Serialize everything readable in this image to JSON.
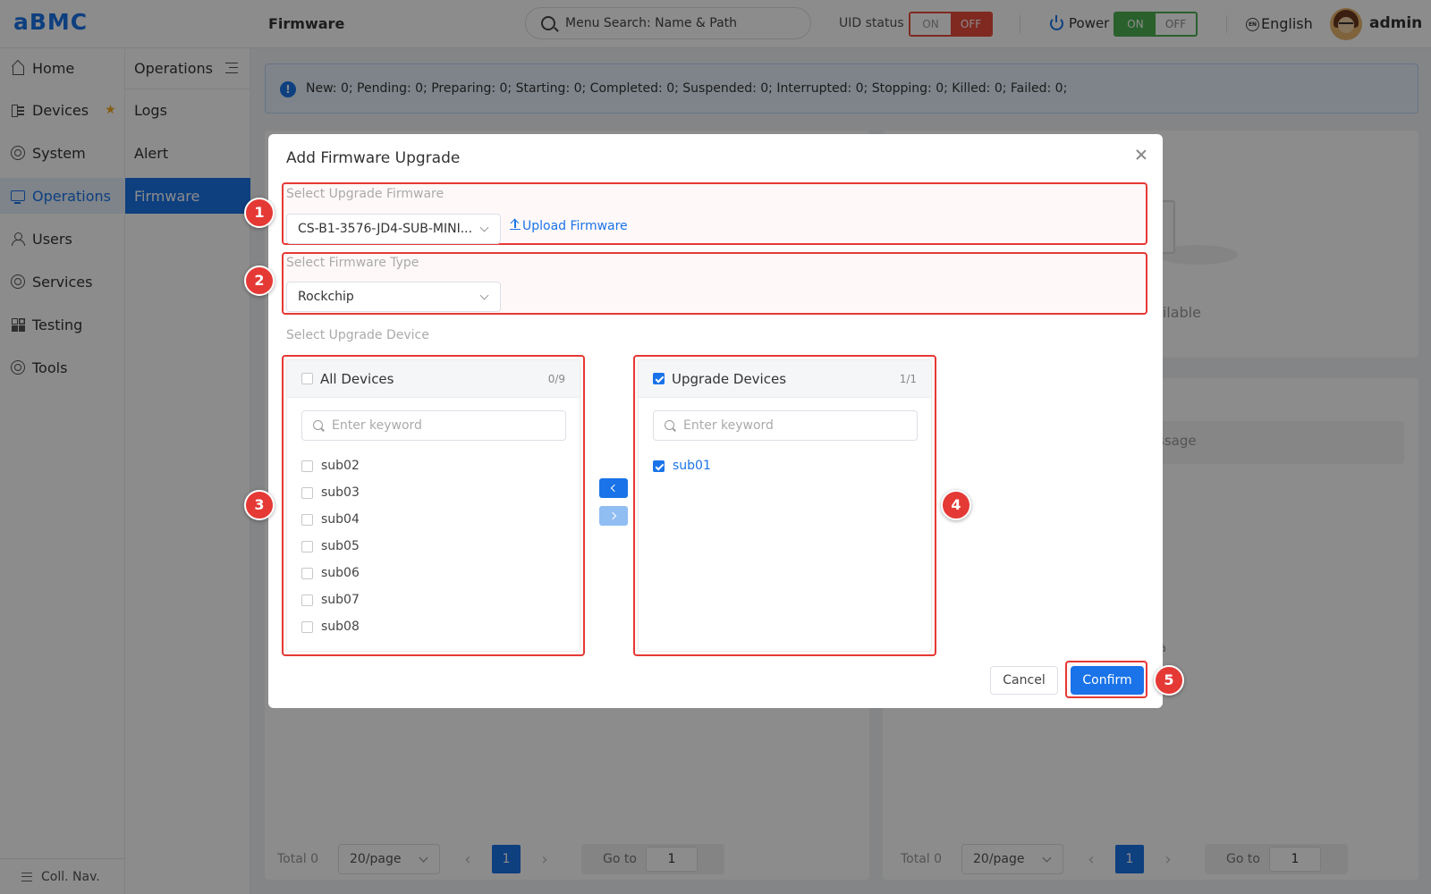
{
  "app": {
    "logo": "aBMC",
    "page_title": "Firmware"
  },
  "header": {
    "search_placeholder": "Menu Search: Name & Path",
    "uid_label": "UID status",
    "uid_on": "ON",
    "uid_off": "OFF",
    "power_label": "Power",
    "power_on": "ON",
    "power_off": "OFF",
    "lang_badge": "EN",
    "language": "English",
    "user": "admin"
  },
  "sidebar": {
    "items": [
      {
        "label": "Home",
        "icon": "home-icon"
      },
      {
        "label": "Devices",
        "icon": "devices-icon",
        "starred": true
      },
      {
        "label": "System",
        "icon": "system-icon"
      },
      {
        "label": "Operations",
        "icon": "operations-icon",
        "active": true
      },
      {
        "label": "Users",
        "icon": "users-icon"
      },
      {
        "label": "Services",
        "icon": "services-icon"
      },
      {
        "label": "Testing",
        "icon": "testing-icon"
      },
      {
        "label": "Tools",
        "icon": "tools-icon"
      }
    ],
    "collapse_label": "Coll. Nav.",
    "star_glyph": "★"
  },
  "subnav": {
    "title": "Operations",
    "items": [
      {
        "label": "Logs"
      },
      {
        "label": "Alert"
      },
      {
        "label": "Firmware",
        "active": true
      }
    ]
  },
  "notice": {
    "icon": "!",
    "text": "New: 0;   Pending: 0;   Preparing: 0;   Starting: 0;   Completed: 0;   Suspended: 0;   Interrupted: 0;   Stopping: 0;   Killed: 0;   Failed: 0;"
  },
  "background": {
    "available_text": "ailable",
    "message_text": "ssage",
    "ta_text": "ta",
    "pager_left": {
      "total": "Total 0",
      "size": "20/page",
      "prev": "‹",
      "page": "1",
      "next": "›",
      "goto": "Go to",
      "goto_value": "1"
    },
    "pager_right": {
      "total": "Total 0",
      "size": "20/page",
      "prev": "‹",
      "page": "1",
      "next": "›",
      "goto": "Go to",
      "goto_value": "1"
    }
  },
  "modal": {
    "title": "Add Firmware Upgrade",
    "firmware_label": "Select Upgrade Firmware",
    "firmware_value": "CS-B1-3576-JD4-SUB-MINI...",
    "upload_label": "Upload Firmware",
    "type_label": "Select Firmware Type",
    "type_value": "Rockchip",
    "device_label": "Select Upgrade Device",
    "left_panel": {
      "title": "All Devices",
      "count": "0/9",
      "search_placeholder": "Enter keyword",
      "items": [
        "sub02",
        "sub03",
        "sub04",
        "sub05",
        "sub06",
        "sub07",
        "sub08"
      ]
    },
    "right_panel": {
      "title": "Upgrade Devices",
      "count": "1/1",
      "search_placeholder": "Enter keyword",
      "items": [
        "sub01"
      ]
    },
    "cancel_label": "Cancel",
    "confirm_label": "Confirm",
    "badges": [
      "1",
      "2",
      "3",
      "4",
      "5"
    ],
    "highlight_color": "#e53935",
    "accent_color": "#1a73e8"
  }
}
